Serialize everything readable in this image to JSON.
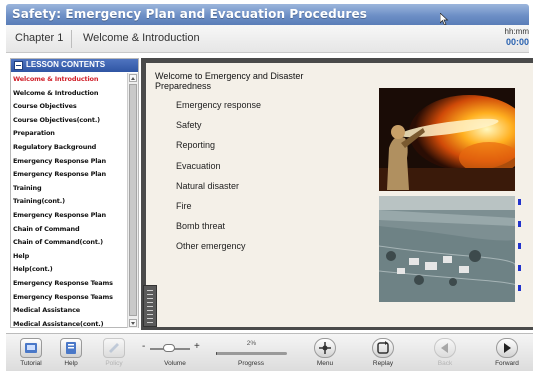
{
  "window": {
    "title": "Safety: Emergency Plan and Evacuation Procedures"
  },
  "chapter_bar": {
    "chapter": "Chapter 1",
    "topic": "Welcome & Introduction",
    "time_label": "hh:mm",
    "time_value": "00:00"
  },
  "sidebar": {
    "header": "LESSON CONTENTS",
    "items": [
      "Welcome & Introduction",
      "Welcome & Introduction",
      "Course Objectives",
      "Course Objectives(cont.)",
      "Preparation",
      "Regulatory Background",
      "Emergency Response Plan",
      "Emergency Response Plan",
      "Training",
      "Training(cont.)",
      "Emergency Response Plan",
      "Chain of Command",
      "Chain of Command(cont.)",
      "Help",
      "Help(cont.)",
      "Emergency Response Teams",
      "Emergency Response Teams",
      "Medical Assistance",
      "Medical Assistance(cont.)"
    ],
    "active_index": 0
  },
  "content": {
    "heading": "Welcome to Emergency and Disaster Preparedness",
    "topics": [
      "Emergency response",
      "Safety",
      "Reporting",
      "Evacuation",
      "Natural disaster",
      "Fire",
      "Bomb threat",
      "Other emergency"
    ],
    "images": [
      {
        "name": "firefighter-photo"
      },
      {
        "name": "flood-aerial-photo"
      }
    ]
  },
  "toolbar": {
    "tutorial": "Tutorial",
    "help": "Help",
    "policy": "Policy",
    "volume": "Volume",
    "volume_minus": "-",
    "volume_plus": "+",
    "progress": "Progress",
    "progress_text": "2%",
    "progress_fraction": 0.02,
    "menu": "Menu",
    "replay": "Replay",
    "back": "Back",
    "forward": "Forward"
  },
  "colors": {
    "title_bar": "#6d8fc6",
    "sidebar_header": "#2f55a3",
    "active_item": "#d0202a",
    "time": "#2a62b0",
    "content_bg": "#f4f0e8"
  }
}
